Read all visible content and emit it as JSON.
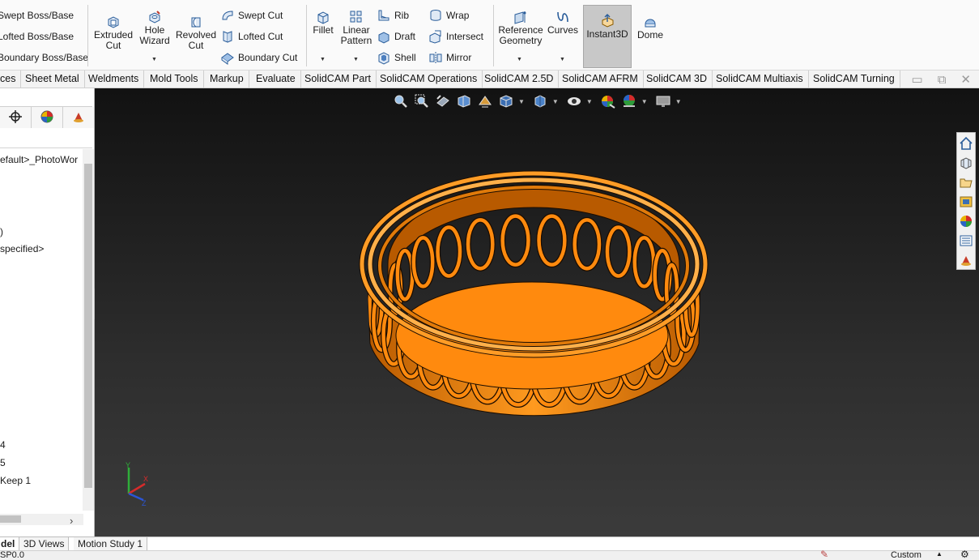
{
  "ribbon": {
    "boss_base": [
      "Swept Boss/Base",
      "Lofted Boss/Base",
      "Boundary Boss/Base"
    ],
    "extruded_cut": "Extruded\nCut",
    "hole_wizard": "Hole\nWizard",
    "revolved_cut": "Revolved\nCut",
    "cuts": [
      "Swept Cut",
      "Lofted Cut",
      "Boundary Cut"
    ],
    "fillet": "Fillet",
    "linear_pattern": "Linear\nPattern",
    "features_mid": [
      "Rib",
      "Draft",
      "Shell"
    ],
    "features_right": [
      "Wrap",
      "Intersect",
      "Mirror"
    ],
    "reference_geometry": "Reference\nGeometry",
    "curves": "Curves",
    "instant3d": "Instant3D",
    "dome": "Dome"
  },
  "tabs": [
    "ces",
    "Sheet Metal",
    "Weldments",
    "Mold Tools",
    "Markup",
    "Evaluate",
    "SolidCAM Part",
    "SolidCAM Operations",
    "SolidCAM 2.5D",
    "SolidCAM AFRM",
    "SolidCAM 3D",
    "SolidCAM Multiaxis",
    "SolidCAM Turning"
  ],
  "tree": {
    "items": [
      "efault>_PhotoWor",
      ")",
      "specified>",
      "4",
      "5",
      "Keep 1"
    ]
  },
  "triad": {
    "x": "X",
    "y": "Y",
    "z": "Z"
  },
  "bottom_tabs": [
    "del",
    "3D Views",
    "Motion Study 1"
  ],
  "status": {
    "left": "SP0.0",
    "right": "Custom"
  },
  "colors": {
    "model_orange": "#ff8a0e",
    "viewport_top": "#121212",
    "viewport_bottom": "#3b3b3b",
    "instant3d_active": "#c8c8c8"
  }
}
